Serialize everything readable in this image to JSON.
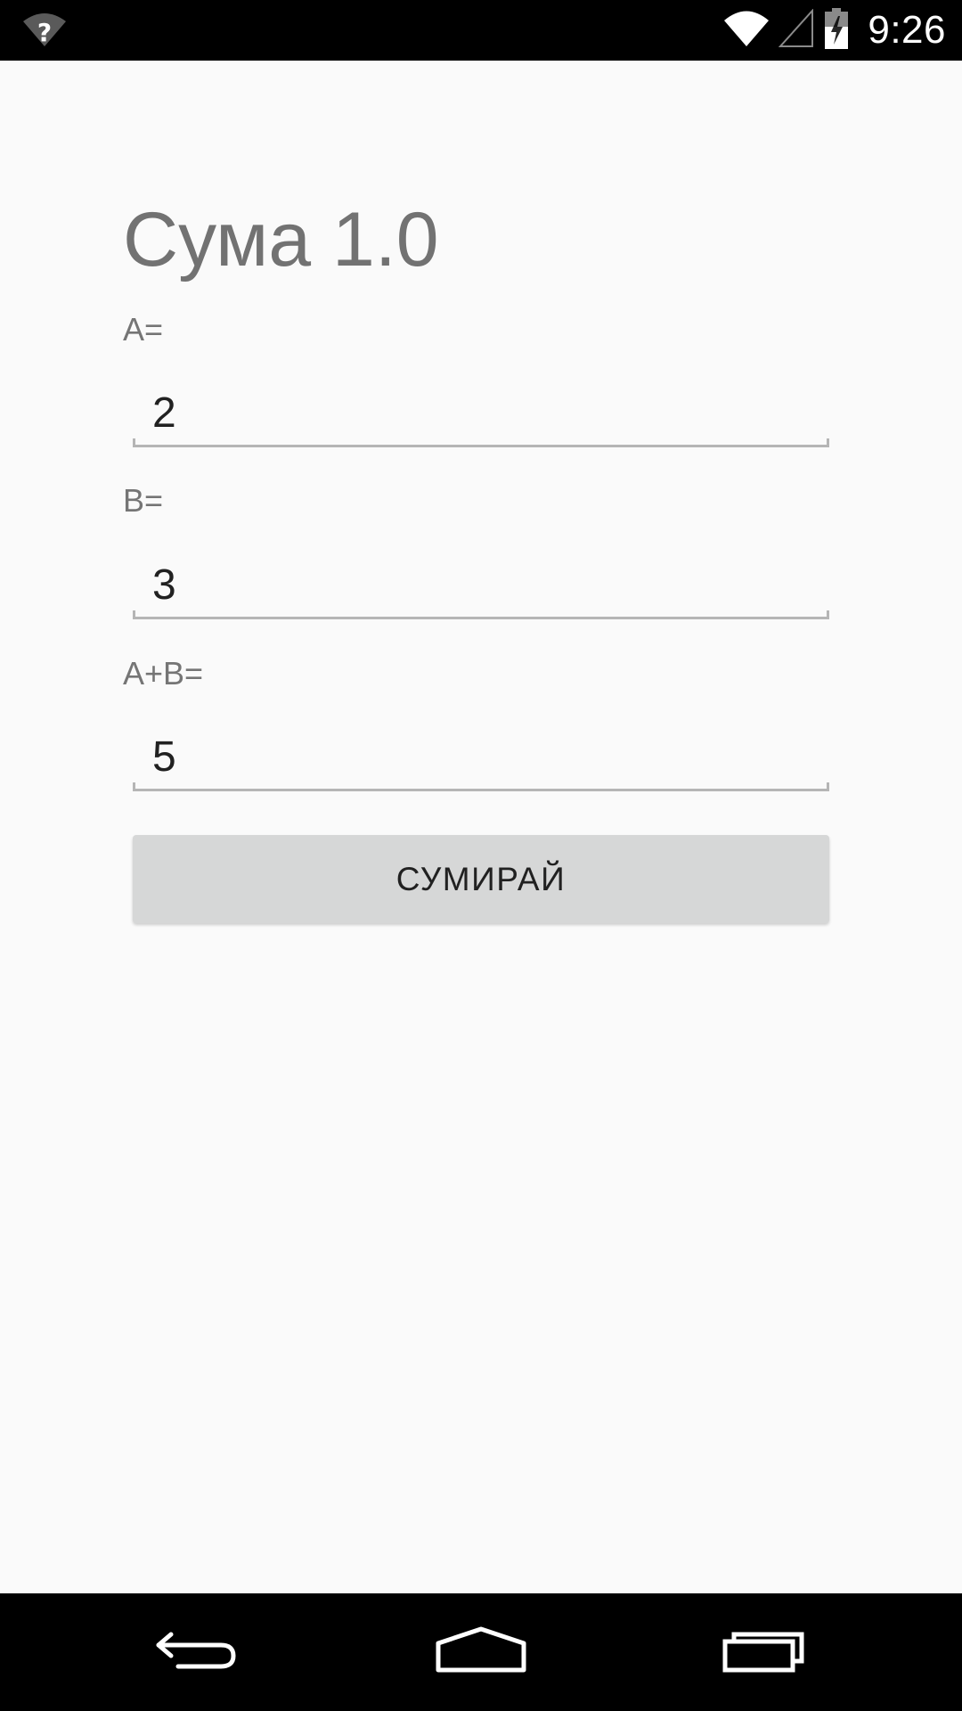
{
  "status_bar": {
    "time": "9:26",
    "icons": [
      "wifi-unknown-icon",
      "wifi-icon",
      "cell-signal-icon",
      "battery-charging-icon"
    ]
  },
  "app": {
    "title": "Сума 1.0"
  },
  "form": {
    "a_label": "A=",
    "a_value": "2",
    "b_label": "B=",
    "b_value": "3",
    "sum_label": "A+B=",
    "sum_value": "5",
    "button_label": "СУМИРАЙ"
  },
  "nav_bar": {
    "icons": [
      "back-icon",
      "home-icon",
      "recents-icon"
    ]
  }
}
